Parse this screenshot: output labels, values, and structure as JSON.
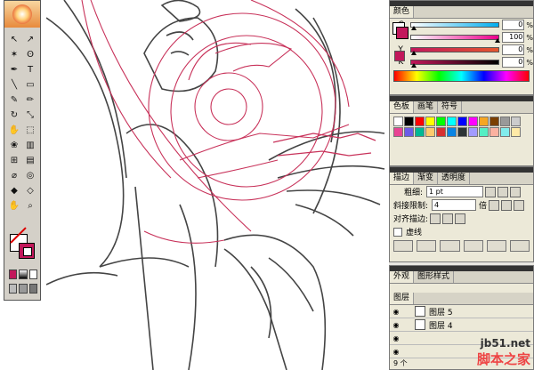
{
  "toolbox": {
    "tools": [
      "selection-arrow",
      "direct-selection-arrow",
      "magic-wand",
      "lasso",
      "pen",
      "type-T",
      "line",
      "rectangle",
      "paintbrush",
      "pencil",
      "rotate",
      "scale",
      "warp",
      "free-transform",
      "symbol-sprayer",
      "column-graph",
      "mesh",
      "gradient",
      "eyedropper",
      "blend",
      "live-paint",
      "live-paint-select",
      "hand",
      "zoom"
    ]
  },
  "color_panel": {
    "tab": "颜色",
    "sliders": [
      {
        "label": "C",
        "value": "0",
        "unit": "%",
        "level": 0.0
      },
      {
        "label": "M",
        "value": "100",
        "unit": "%",
        "level": 1.0
      },
      {
        "label": "Y",
        "value": "0",
        "unit": "%",
        "level": 0.0
      },
      {
        "label": "K",
        "value": "0",
        "unit": "%",
        "level": 0.0
      }
    ]
  },
  "swatches_panel": {
    "tabs": [
      "色板",
      "画笔",
      "符号"
    ],
    "colors": [
      "#ffffff",
      "#000000",
      "#ff0000",
      "#ffff00",
      "#00ff00",
      "#00ffff",
      "#0000ff",
      "#ff00ff",
      "#f5a623",
      "#7b3f00",
      "#999999",
      "#cccccc",
      "#e84393",
      "#6c5ce7",
      "#00b894",
      "#fdcb6e",
      "#d63031",
      "#0984e3",
      "#2d3436",
      "#a29bfe",
      "#55efc4",
      "#fab1a0",
      "#81ecec",
      "#ffeaa7"
    ]
  },
  "stroke_panel": {
    "tabs": [
      "描边",
      "渐变",
      "透明度"
    ],
    "weight_label": "粗细:",
    "weight_value": "1 pt",
    "miter_label": "斜接限制:",
    "miter_value": "4",
    "miter_unit": "倍",
    "align_label": "对齐描边:",
    "dashed_label": "虚线"
  },
  "appearance_panel": {
    "tabs": [
      "外观",
      "图形样式"
    ],
    "layers_tab": "图层",
    "layers": [
      {
        "name": "图层 5"
      },
      {
        "name": "图层 4"
      }
    ],
    "footer": "9 个"
  },
  "watermark": {
    "line1": "jb51.net",
    "line2": "脚本之家"
  }
}
